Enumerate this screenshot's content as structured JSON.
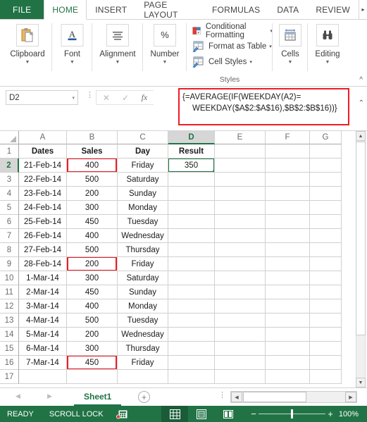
{
  "ribbon_tabs": {
    "file": "FILE",
    "items": [
      "HOME",
      "INSERT",
      "PAGE LAYOUT",
      "FORMULAS",
      "DATA",
      "REVIEW"
    ],
    "active": "HOME",
    "overflow_icon": "chevron-right-icon"
  },
  "ribbon_groups": [
    {
      "id": "clipboard",
      "label": "Clipboard",
      "icon": "clipboard-icon",
      "has_dropdown": true
    },
    {
      "id": "font",
      "label": "Font",
      "icon": "font-a-icon",
      "has_dropdown": true
    },
    {
      "id": "alignment",
      "label": "Alignment",
      "icon": "align-lines-icon",
      "has_dropdown": true
    },
    {
      "id": "number",
      "label": "Number",
      "icon": "percent-icon",
      "has_dropdown": true
    },
    {
      "id": "cells",
      "label": "Cells",
      "icon": "cells-table-icon",
      "has_dropdown": true
    },
    {
      "id": "editing",
      "label": "Editing",
      "icon": "binoculars-icon",
      "has_dropdown": true
    }
  ],
  "styles_group": {
    "title": "Styles",
    "items": [
      {
        "label": "Conditional Formatting",
        "icon": "conditional-formatting-icon",
        "dropdown": "▾"
      },
      {
        "label": "Format as Table",
        "icon": "format-as-table-icon",
        "dropdown": "▾"
      },
      {
        "label": "Cell Styles",
        "icon": "cell-styles-icon",
        "dropdown": "▾"
      }
    ]
  },
  "collapse_ribbon_icon": "chevron-up-icon",
  "formula_bar": {
    "name_box_value": "D2",
    "name_box_caret": "▾",
    "cancel_icon": "✕",
    "enter_icon": "✓",
    "fx_label": "fx",
    "formula_line1": "{=AVERAGE(IF(WEEKDAY(A2)=",
    "formula_line2": "WEEKDAY($A$2:$A$16),$B$2:$B$16))}",
    "expand_icon": "⌃",
    "highlight_color": "#ee1c25"
  },
  "grid": {
    "columns": [
      "A",
      "B",
      "C",
      "D",
      "E",
      "F",
      "G"
    ],
    "selected_column": "D",
    "selected_row": "2",
    "row_numbers": [
      "1",
      "2",
      "3",
      "4",
      "5",
      "6",
      "7",
      "8",
      "9",
      "10",
      "11",
      "12",
      "13",
      "14",
      "15",
      "16",
      "17"
    ],
    "rows": [
      {
        "n": "1",
        "a": "Dates",
        "b": "Sales",
        "c": "Day",
        "d": "Result",
        "header": true
      },
      {
        "n": "2",
        "a": "21-Feb-14",
        "b": "400",
        "c": "Friday",
        "d": "350",
        "b_redbox": true,
        "d_active": true
      },
      {
        "n": "3",
        "a": "22-Feb-14",
        "b": "500",
        "c": "Saturday",
        "d": ""
      },
      {
        "n": "4",
        "a": "23-Feb-14",
        "b": "200",
        "c": "Sunday",
        "d": ""
      },
      {
        "n": "5",
        "a": "24-Feb-14",
        "b": "300",
        "c": "Monday",
        "d": ""
      },
      {
        "n": "6",
        "a": "25-Feb-14",
        "b": "450",
        "c": "Tuesday",
        "d": ""
      },
      {
        "n": "7",
        "a": "26-Feb-14",
        "b": "400",
        "c": "Wednesday",
        "d": ""
      },
      {
        "n": "8",
        "a": "27-Feb-14",
        "b": "500",
        "c": "Thursday",
        "d": ""
      },
      {
        "n": "9",
        "a": "28-Feb-14",
        "b": "200",
        "c": "Friday",
        "d": "",
        "b_redbox": true
      },
      {
        "n": "10",
        "a": "1-Mar-14",
        "b": "300",
        "c": "Saturday",
        "d": ""
      },
      {
        "n": "11",
        "a": "2-Mar-14",
        "b": "450",
        "c": "Sunday",
        "d": ""
      },
      {
        "n": "12",
        "a": "3-Mar-14",
        "b": "400",
        "c": "Monday",
        "d": ""
      },
      {
        "n": "13",
        "a": "4-Mar-14",
        "b": "500",
        "c": "Tuesday",
        "d": ""
      },
      {
        "n": "14",
        "a": "5-Mar-14",
        "b": "200",
        "c": "Wednesday",
        "d": ""
      },
      {
        "n": "15",
        "a": "6-Mar-14",
        "b": "300",
        "c": "Thursday",
        "d": ""
      },
      {
        "n": "16",
        "a": "7-Mar-14",
        "b": "450",
        "c": "Friday",
        "d": "",
        "b_redbox": true
      },
      {
        "n": "17",
        "a": "",
        "b": "",
        "c": "",
        "d": ""
      }
    ]
  },
  "sheet_bar": {
    "prev_icon": "◀",
    "next_icon": "▶",
    "tabs": [
      "Sheet1"
    ],
    "active_tab": "Sheet1",
    "add_sheet_icon": "+",
    "hscroll_left_icon": "◀",
    "hscroll_right_icon": "▶"
  },
  "status_bar": {
    "mode": "READY",
    "scroll_lock": "SCROLL LOCK",
    "macro_icon": "record-macro-icon",
    "views": [
      {
        "name": "normal-view",
        "icon": "grid-icon",
        "active": true
      },
      {
        "name": "page-layout-view",
        "icon": "page-icon",
        "active": false
      },
      {
        "name": "page-break-view",
        "icon": "book-icon",
        "active": false
      }
    ],
    "zoom_out_icon": "−",
    "zoom_in_icon": "+",
    "zoom_value": "100%",
    "background_color": "#217346"
  }
}
